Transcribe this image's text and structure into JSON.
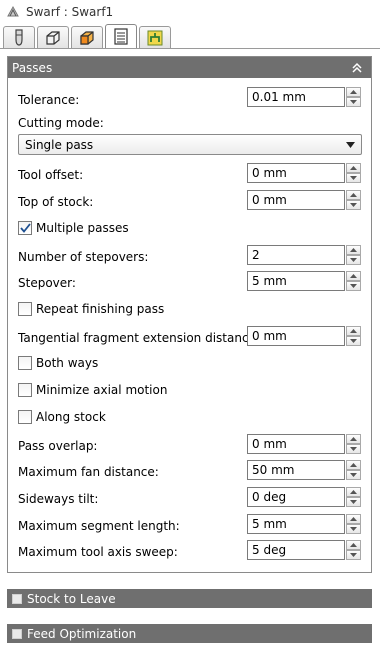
{
  "window": {
    "title": "Swarf : Swarf1"
  },
  "tabs": [
    {
      "icon": "tool-icon"
    },
    {
      "icon": "stock-box-icon"
    },
    {
      "icon": "geometry-box-icon"
    },
    {
      "icon": "passes-icon",
      "active": true
    },
    {
      "icon": "linking-icon"
    }
  ],
  "passes": {
    "header": "Passes",
    "tolerance": {
      "label": "Tolerance:",
      "value": "0.01 mm"
    },
    "cutting_mode": {
      "label": "Cutting mode:",
      "value": "Single pass"
    },
    "tool_offset": {
      "label": "Tool offset:",
      "value": "0 mm"
    },
    "top_of_stock": {
      "label": "Top of stock:",
      "value": "0 mm"
    },
    "multiple_passes": {
      "label": "Multiple passes",
      "checked": true
    },
    "number_of_stepovers": {
      "label": "Number of stepovers:",
      "value": "2"
    },
    "stepover": {
      "label": "Stepover:",
      "value": "5 mm"
    },
    "repeat_finishing_pass": {
      "label": "Repeat finishing pass",
      "checked": false
    },
    "tangential_extension": {
      "label": "Tangential fragment extension distance:",
      "value": "0 mm"
    },
    "both_ways": {
      "label": "Both ways",
      "checked": false
    },
    "minimize_axial_motion": {
      "label": "Minimize axial motion",
      "checked": false
    },
    "along_stock": {
      "label": "Along stock",
      "checked": false
    },
    "pass_overlap": {
      "label": "Pass overlap:",
      "value": "0 mm"
    },
    "max_fan_distance": {
      "label": "Maximum fan distance:",
      "value": "50 mm"
    },
    "sideways_tilt": {
      "label": "Sideways tilt:",
      "value": "0 deg"
    },
    "max_segment_length": {
      "label": "Maximum segment length:",
      "value": "5 mm"
    },
    "max_tool_axis_sweep": {
      "label": "Maximum tool axis sweep:",
      "value": "5 deg"
    }
  },
  "sections": {
    "stock_to_leave": "Stock to Leave",
    "feed_optimization": "Feed Optimization"
  },
  "colors": {
    "header_bg": "#6f6f6f",
    "accent": "#3a6fc4"
  }
}
